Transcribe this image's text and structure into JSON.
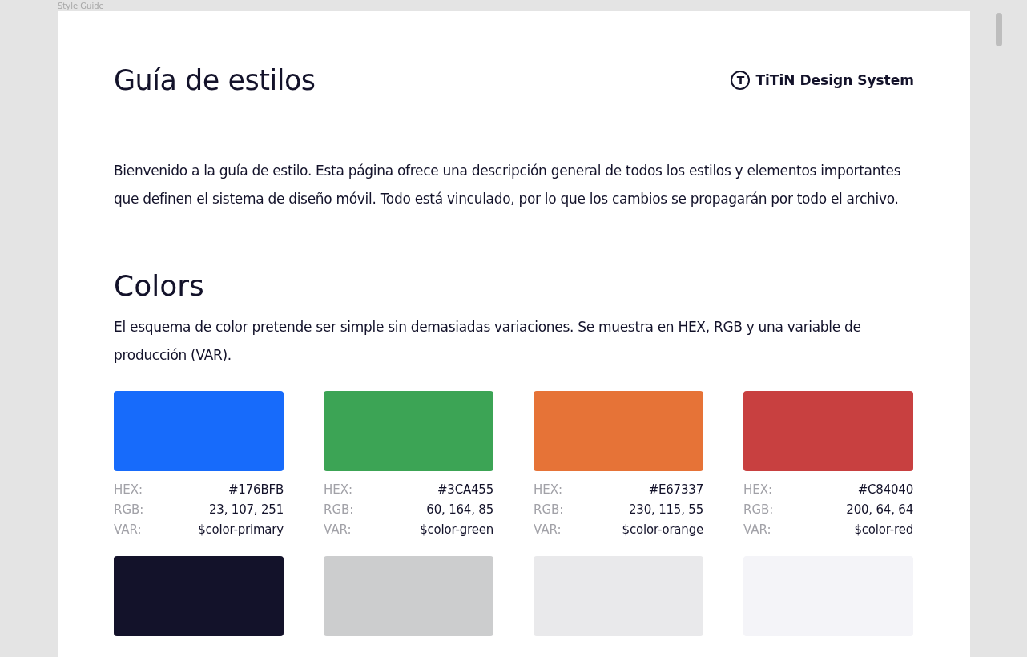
{
  "frame_label": "Style Guide",
  "header": {
    "title": "Guía de estilos",
    "brand": {
      "mark": "T",
      "name": "TiTiN Design System"
    }
  },
  "intro": "Bienvenido a la guía de estilo. Esta página ofrece una descripción general de todos los estilos y elementos importantes que definen el sistema de diseño móvil. Todo está vinculado, por lo que los cambios se propagarán por todo el archivo.",
  "colors": {
    "title": "Colors",
    "description": "El esquema de color pretende ser simple sin demasiadas variaciones. Se muestra en HEX, RGB y una variable de producción (VAR).",
    "swatches": [
      {
        "color": "#176bfb",
        "specs": [
          {
            "label": "HEX:",
            "value": "#176BFB"
          },
          {
            "label": "RGB:",
            "value": "23, 107, 251"
          },
          {
            "label": "VAR:",
            "value": "$color-primary"
          }
        ]
      },
      {
        "color": "#3ca455",
        "specs": [
          {
            "label": "HEX:",
            "value": "#3CA455"
          },
          {
            "label": "RGB:",
            "value": "60, 164, 85"
          },
          {
            "label": "VAR:",
            "value": "$color-green"
          }
        ]
      },
      {
        "color": "#e67337",
        "specs": [
          {
            "label": "HEX:",
            "value": "#E67337"
          },
          {
            "label": "RGB:",
            "value": "230, 115, 55"
          },
          {
            "label": "VAR:",
            "value": "$color-orange"
          }
        ]
      },
      {
        "color": "#c84040",
        "specs": [
          {
            "label": "HEX:",
            "value": "#C84040"
          },
          {
            "label": "RGB:",
            "value": "200, 64, 64"
          },
          {
            "label": "VAR:",
            "value": "$color-red"
          }
        ]
      },
      {
        "color": "#13122a"
      },
      {
        "color": "#cccdce"
      },
      {
        "color": "#e9e9eb"
      },
      {
        "color": "#f4f4f8"
      }
    ]
  }
}
